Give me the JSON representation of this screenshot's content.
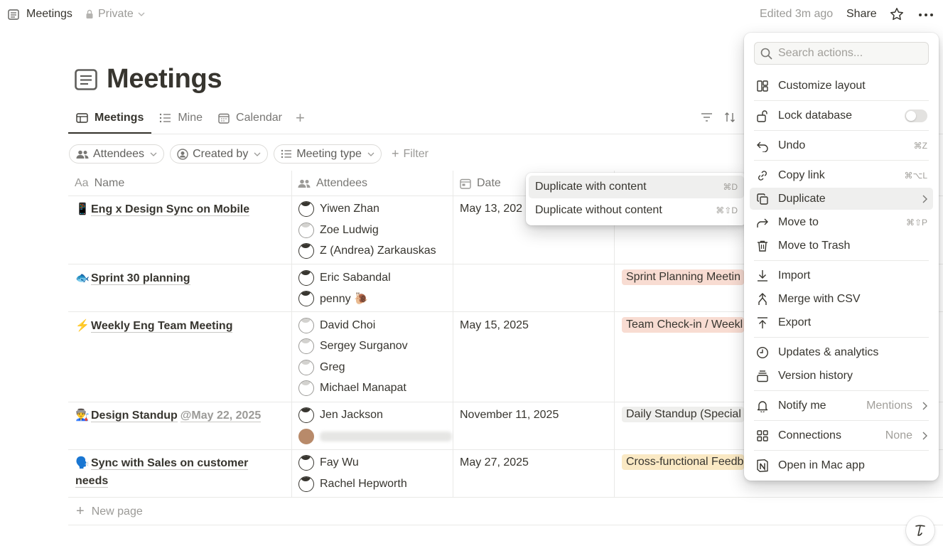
{
  "topbar": {
    "title": "Meetings",
    "privacy": "Private",
    "edited": "Edited 3m ago",
    "share": "Share"
  },
  "page": {
    "title": "Meetings"
  },
  "tabs": [
    {
      "label": "Meetings"
    },
    {
      "label": "Mine"
    },
    {
      "label": "Calendar"
    }
  ],
  "filters": [
    {
      "label": "Attendees"
    },
    {
      "label": "Created by"
    },
    {
      "label": "Meeting type"
    }
  ],
  "add_filter": "Filter",
  "columns": {
    "name": "Name",
    "name_prefix": "Aa",
    "attendees": "Attendees",
    "date": "Date"
  },
  "rows": [
    {
      "emoji": "📱",
      "name": "Eng x Design Sync on Mobile",
      "mention": "",
      "attendees": [
        "Yiwen Zhan",
        "Zoe Ludwig",
        "Z (Andrea) Zarkauskas"
      ],
      "date": "May 13, 202",
      "tag": ""
    },
    {
      "emoji": "🐟",
      "name": "Sprint 30 planning",
      "mention": "",
      "attendees": [
        "Eric Sabandal",
        "penny 🐌"
      ],
      "date": "",
      "tag": "Sprint Planning Meetin"
    },
    {
      "emoji": "⚡",
      "name": "Weekly Eng Team Meeting",
      "mention": "",
      "attendees": [
        "David Choi",
        "Sergey Surganov",
        "Greg",
        "Michael Manapat"
      ],
      "date": "May 15, 2025",
      "tag": "Team Check-in / Weekl"
    },
    {
      "emoji": "👨‍🏭",
      "name": "Design Standup",
      "mention": "@May 22, 2025",
      "attendees": [
        "Jen Jackson",
        ""
      ],
      "date": "November 11, 2025",
      "tag": "Daily Standup (Special"
    },
    {
      "emoji": "🗣️",
      "name_line1": "Sync with Sales on customer",
      "name_line2": "needs",
      "attendees": [
        "Fay Wu",
        "Rachel Hepworth"
      ],
      "date": "May 27, 2025",
      "tag": "Cross-functional Feedb"
    }
  ],
  "new_page": "New page",
  "submenu": {
    "items": [
      {
        "label": "Duplicate with content",
        "shortcut": "⌘D"
      },
      {
        "label": "Duplicate without content",
        "shortcut": "⌘⇧D"
      }
    ]
  },
  "menu": {
    "search_placeholder": "Search actions...",
    "items": [
      {
        "label": "Customize layout",
        "icon": "layout-icon"
      },
      {
        "label": "Lock database",
        "icon": "lock-icon"
      },
      {
        "label": "Undo",
        "shortcut": "⌘Z",
        "icon": "undo-icon"
      },
      {
        "label": "Copy link",
        "shortcut": "⌘⌥L",
        "icon": "link-icon"
      },
      {
        "label": "Duplicate",
        "icon": "duplicate-icon"
      },
      {
        "label": "Move to",
        "shortcut": "⌘⇧P",
        "icon": "move-icon"
      },
      {
        "label": "Move to Trash",
        "icon": "trash-icon"
      },
      {
        "label": "Import",
        "icon": "import-icon"
      },
      {
        "label": "Merge with CSV",
        "icon": "merge-icon"
      },
      {
        "label": "Export",
        "icon": "export-icon"
      },
      {
        "label": "Updates & analytics",
        "icon": "clock-icon"
      },
      {
        "label": "Version history",
        "icon": "history-icon"
      },
      {
        "label": "Notify me",
        "value": "Mentions",
        "icon": "bell-icon"
      },
      {
        "label": "Connections",
        "value": "None",
        "icon": "connections-icon"
      },
      {
        "label": "Open in Mac app",
        "icon": "notion-app-icon"
      }
    ]
  },
  "colors": {
    "tag_sprint": "#f8dcd2",
    "tag_team": "#f8dcd2",
    "tag_standup": "#efefed",
    "tag_crossfunc": "#fae9c4"
  }
}
